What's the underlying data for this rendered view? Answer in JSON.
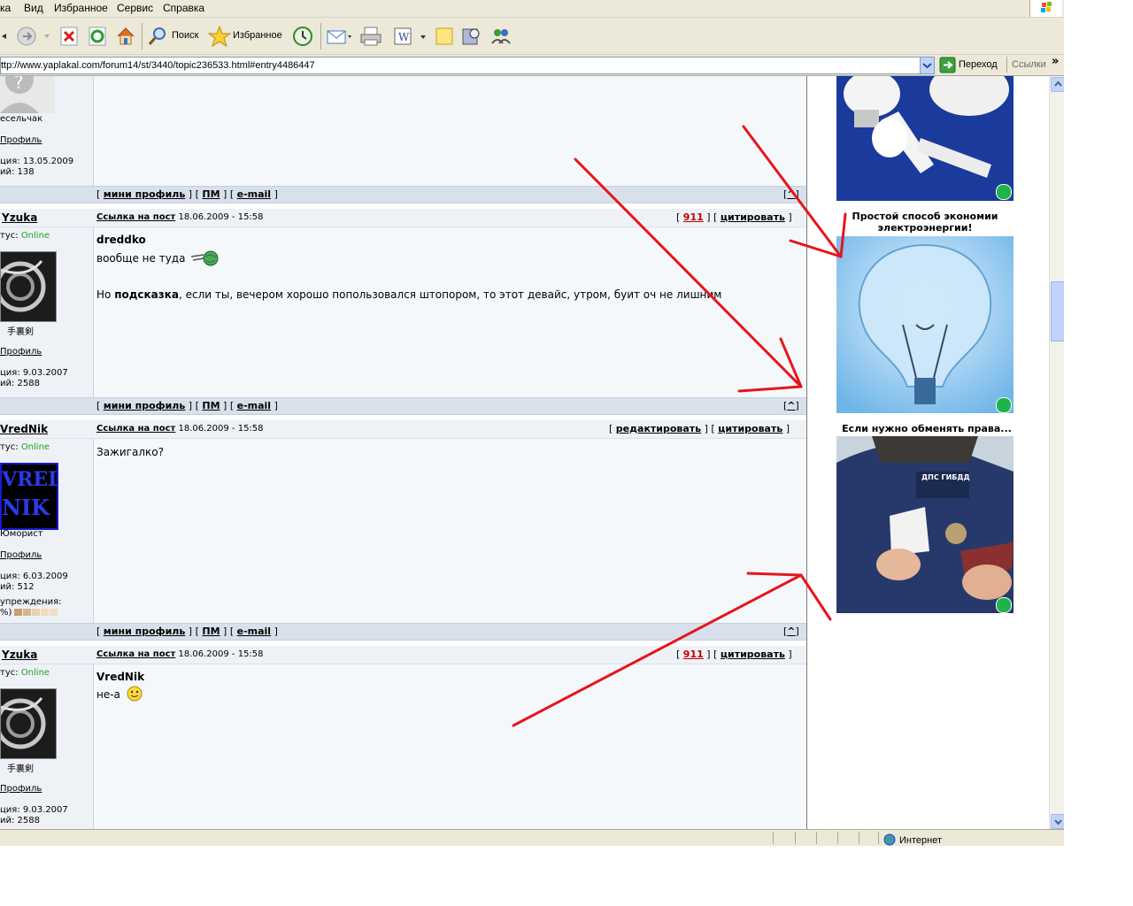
{
  "menu": {
    "items": [
      "ка",
      "Вид",
      "Избранное",
      "Сервис",
      "Справка"
    ]
  },
  "toolbar": {
    "search_label": "Поиск",
    "favorites_label": "Избранное"
  },
  "address": {
    "url": "ttp://www.yaplakal.com/forum14/st/3440/topic236533.html#entry4486447",
    "go_label": "Переход",
    "links_label": "Ссылки",
    "more": "»"
  },
  "posts": {
    "p0": {
      "rank": "есельчак",
      "profile": "Профиль",
      "reg": "ция: 13.05.2009",
      "count": "ий: 138"
    },
    "p1": {
      "author": "Yzuka",
      "status_label": "тус:",
      "status": "Online",
      "avatar_caption": "手裏剣",
      "profile": "Профиль",
      "reg": "ция: 9.03.2007",
      "count": "ий: 2588",
      "postlink": "Ссылка на пост",
      "date": "18.06.2009 - 15:58",
      "num": "911",
      "quote": "цитировать",
      "quoted_author": "dreddko",
      "line1": "вообще не туда",
      "line2_pre": "Но ",
      "line2_bold": "подсказка",
      "line2_post": ", если ты, вечером хорошо попользовался штопором, то этот девайс, утром, буит оч не лишним"
    },
    "p2": {
      "author": "VredNik",
      "status_label": "тус:",
      "status": "Online",
      "avatar_text1": "VRED",
      "avatar_text2": "NIK",
      "rank": "Юморист",
      "profile": "Профиль",
      "reg": "ция: 6.03.2009",
      "count": "ий: 512",
      "warn_label": "упреждения:",
      "warn_pct": "%)",
      "postlink": "Ссылка на пост",
      "date": "18.06.2009 - 15:58",
      "edit": "редактировать",
      "quote": "цитировать",
      "text": "Зажигалко?"
    },
    "p3": {
      "author": "Yzuka",
      "status_label": "тус:",
      "status": "Online",
      "avatar_caption": "手裏剣",
      "profile": "Профиль",
      "reg": "ция: 9.03.2007",
      "count": "ий: 2588",
      "postlink": "Ссылка на пост",
      "date": "18.06.2009 - 15:58",
      "num": "911",
      "quote": "цитировать",
      "quoted_author": "VredNik",
      "line1": "не-а"
    }
  },
  "bar": {
    "mini": "мини профиль",
    "pm": "ПМ",
    "email": "e-mail",
    "top": "^"
  },
  "ads": {
    "ad1_title": "Простой способ экономии электроэнергии!",
    "ad2_title": "Если нужно обменять права...",
    "badge": "ДПС ГИБДД"
  },
  "statusbar": {
    "zone": "Интернет"
  },
  "colors": {
    "annotation": "#e8141b",
    "online": "#1fa11f",
    "bar": "#d8e1eb"
  }
}
